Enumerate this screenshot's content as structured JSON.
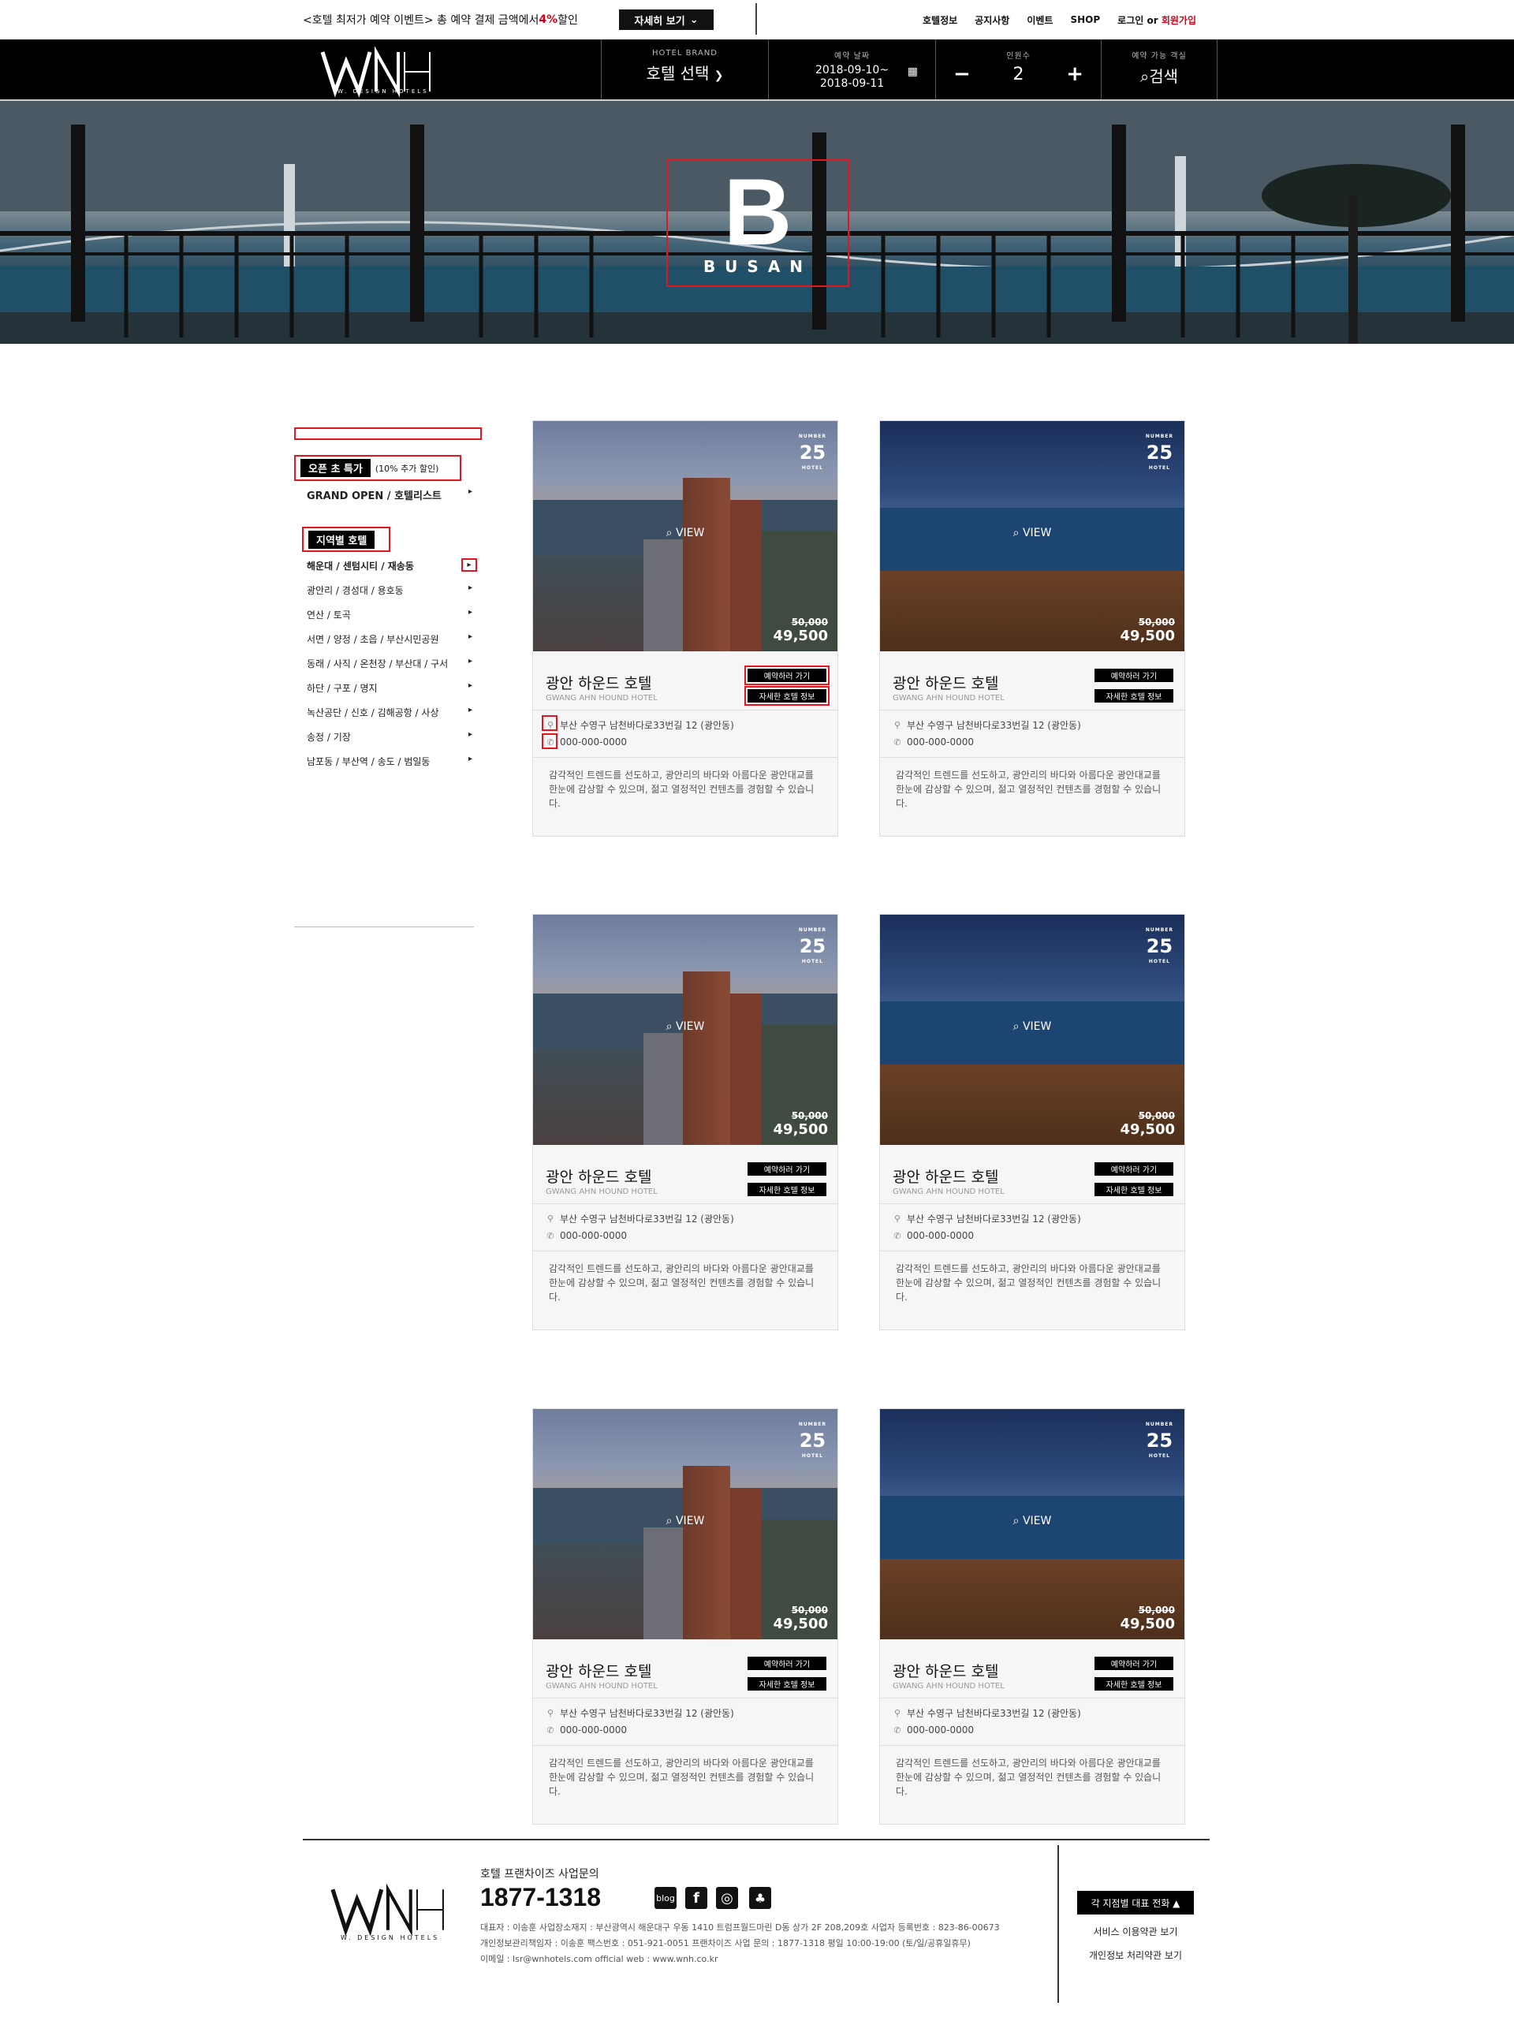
{
  "promo": {
    "text_before": "<호텔 최저가 예약 이벤트> 총 예약 결제 금액에서 ",
    "percent": "4%",
    "text_after": " 할인",
    "button": "자세히 보기"
  },
  "topnav": [
    "호텔정보",
    "공지사항",
    "이벤트",
    "SHOP"
  ],
  "login": "로그인",
  "or": "or",
  "join": "회원가입",
  "logo": {
    "mark": "WNH",
    "sub": "W. DESIGN HOTELS"
  },
  "search": {
    "brand_label": "HOTEL BRAND",
    "brand_value": "호텔 선택",
    "date_label": "예약 날짜",
    "date_from": "2018-09-10~",
    "date_to": "2018-09-11",
    "guest_label": "인원수",
    "guest_value": "2",
    "minus": "−",
    "plus": "+",
    "room_label": "예약 가능 객실",
    "search_button": "검색"
  },
  "hero": {
    "letter": "B",
    "city": "BUSAN"
  },
  "sidebar": {
    "open_tag": "오픈 초 특가",
    "open_note": "(10% 추가 할인)",
    "grand": "GRAND OPEN / 호텔리스트",
    "region_tag": "지역별 호텔",
    "regions": [
      "해운대 / 센텀시티 / 재송동",
      "광안리 / 경성대 / 용호동",
      "연산 / 토곡",
      "서면 / 양정 / 초읍 / 부산시민공원",
      "동래 / 사직 / 온천장 / 부산대 / 구서",
      "하단 / 구포 / 명지",
      "녹산공단 / 신호 / 김해공항 / 사상",
      "송정 / 기장",
      "남포동 / 부산역 / 송도 / 범일동"
    ]
  },
  "card": {
    "view": "VIEW",
    "badge_top": "NUMBER",
    "badge_num": "25",
    "badge_bottom": "HOTEL",
    "old_price": "50,000",
    "new_price": "49,500",
    "name": "광안 하운드 호텔",
    "name_en": "GWANG AHN HOUND HOTEL",
    "book": "예약하러 가기",
    "detail": "자세한 호텔 정보",
    "address": "부산 수영구 남천바다로33번길 12 (광안동)",
    "tel": "000-000-0000",
    "desc": "감각적인 트렌드를 선도하고, 광안리의 바다와 아름다운 광안대교를 한눈에 감상할 수 있으며, 젊고 열정적인 컨텐츠를 경험할 수 있습니다."
  },
  "footer": {
    "inquiry": "호텔 프랜차이즈 사업문의",
    "phone": "1877-1318",
    "sns": [
      "blog",
      "f",
      "◎",
      "♣"
    ],
    "line1": "대표자 : 이송훈   사업장소재지 : 부산광역시 해운대구 우동 1410 트럼프월드마린 D동 상가 2F 208,209호   사업자 등록번호 : 823-86-00673",
    "line2": "개인정보관리책임자 : 이송훈   팩스번호 : 051-921-0051   프랜차이즈 사업 문의 : 1877-1318   평일 10:00-19:00 (토/일/공휴일휴무)",
    "line3": "이메일 : lsr@wnhotels.com   official web : www.wnh.co.kr",
    "call_button": "각 지점별 대표 전화 ▲",
    "terms": "서비스 이용약관 보기",
    "privacy": "개인정보 처리약관 보기"
  }
}
